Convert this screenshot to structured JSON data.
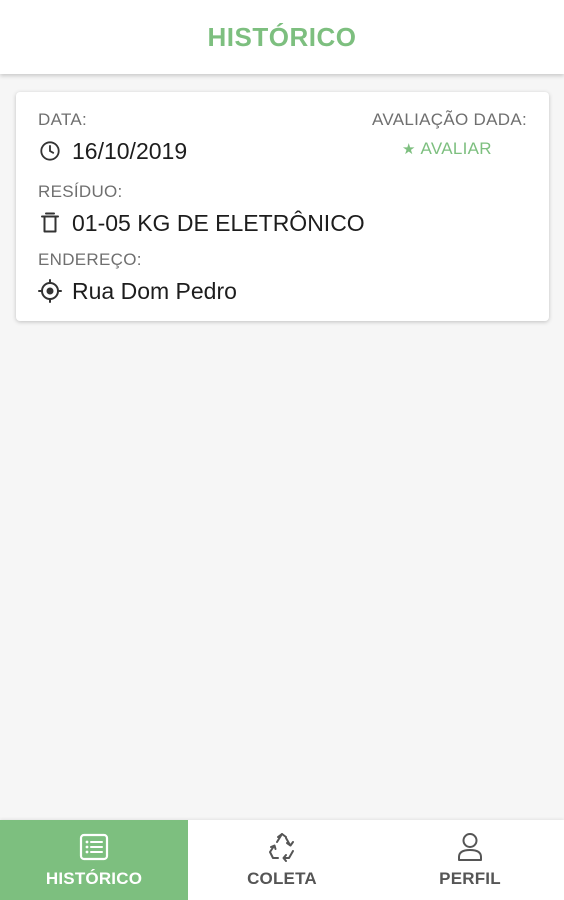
{
  "header": {
    "title": "HISTÓRICO"
  },
  "history_card": {
    "date_label": "DATA:",
    "date_value": "16/10/2019",
    "date_icon": "clock-icon",
    "waste_label": "RESÍDUO:",
    "waste_value": "01-05 KG DE ELETRÔNICO",
    "waste_icon": "trash-icon",
    "address_label": "ENDEREÇO:",
    "address_value": "Rua Dom Pedro",
    "address_icon": "location-icon",
    "rating_label": "AVALIAÇÃO DADA:",
    "rate_button_label": "AVALIAR",
    "rate_icon": "star-icon"
  },
  "bottom_nav": {
    "items": [
      {
        "label": "HISTÓRICO",
        "icon": "list-icon",
        "active": true
      },
      {
        "label": "COLETA",
        "icon": "recycle-icon",
        "active": false
      },
      {
        "label": "PERFIL",
        "icon": "user-icon",
        "active": false
      }
    ]
  },
  "colors": {
    "accent": "#7dbf7f",
    "background": "#f6f6f6",
    "card": "#ffffff",
    "label_text": "#6f6f6f",
    "value_text": "#1d1d1d"
  }
}
